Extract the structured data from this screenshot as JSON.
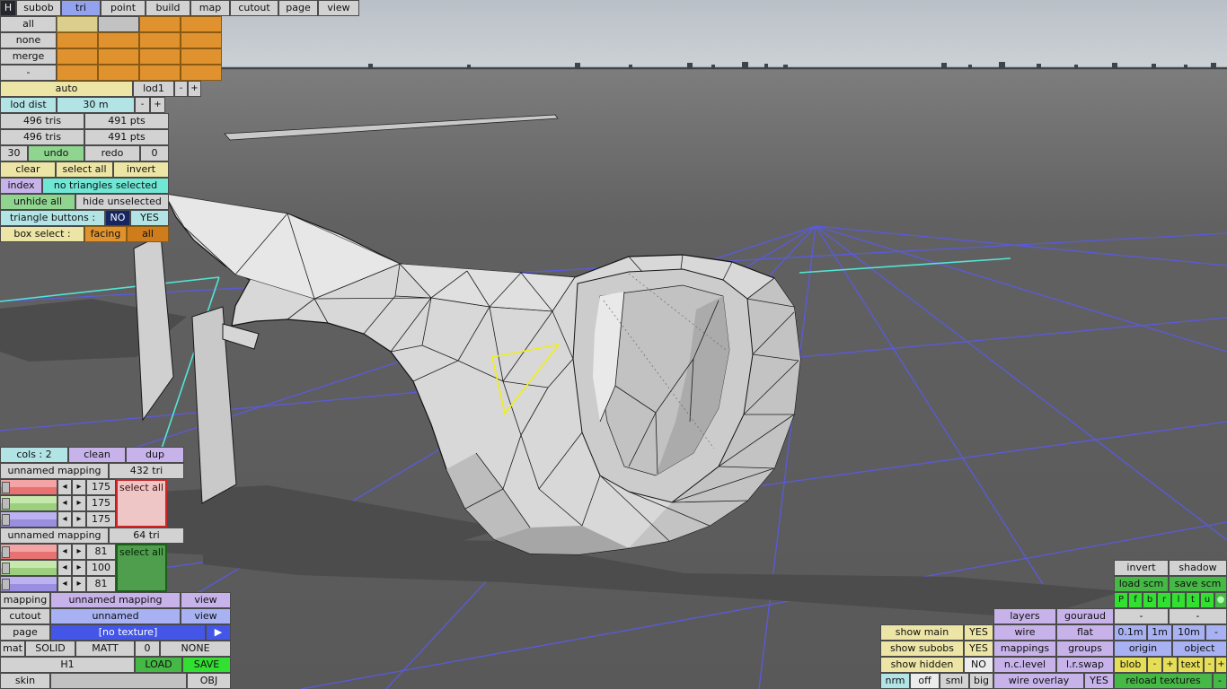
{
  "topbar": {
    "items": [
      "H",
      "subob",
      "tri",
      "point",
      "build",
      "map",
      "cutout",
      "page",
      "view"
    ]
  },
  "toolPanel": {
    "side": [
      "all",
      "none",
      "merge",
      "-"
    ],
    "autoRow": {
      "auto": "auto",
      "lod": "lod1",
      "minus": "-",
      "plus": "+"
    },
    "lodDist": {
      "label": "lod dist",
      "value": "30 m",
      "minus": "-",
      "plus": "+"
    },
    "stats": {
      "tris": "496 tris",
      "pts": "491 pts",
      "tris2": "496 tris",
      "pts2": "491 pts"
    },
    "undoRow": {
      "count": "30",
      "undo": "undo",
      "redo": "redo",
      "zero": "0"
    },
    "selRow": {
      "clear": "clear",
      "selectAll": "select all",
      "invert": "invert"
    },
    "indexRow": {
      "label": "index",
      "status": "no triangles selected"
    },
    "hideRow": {
      "unhide": "unhide all",
      "hideUnselected": "hide unselected"
    },
    "triRow": {
      "label": "triangle buttons :",
      "no": "NO",
      "yes": "YES"
    },
    "boxRow": {
      "label": "box select :",
      "facing": "facing",
      "all": "all"
    }
  },
  "colsPanel": {
    "header": {
      "cols": "cols : 2",
      "clean": "clean",
      "dup": "dup"
    },
    "arrows": {
      "left": "◂",
      "right": "▸"
    },
    "groups": [
      {
        "name": "unnamed mapping",
        "count": "432 tri",
        "selectAll": "select all",
        "values": [
          "175",
          "175",
          "175"
        ]
      },
      {
        "name": "unnamed mapping",
        "count": "64 tri",
        "selectAll": "select all",
        "values": [
          "81",
          "100",
          "81"
        ]
      }
    ],
    "mappingRow": {
      "label": "mapping",
      "value": "unnamed mapping",
      "view": "view"
    },
    "cutoutRow": {
      "label": "cutout",
      "value": "unnamed",
      "view": "view"
    },
    "pageRow": {
      "label": "page",
      "value": "[no texture]",
      "arrow": "▶"
    },
    "matRow": {
      "label": "mat",
      "a": "SOLID",
      "b": "MATT",
      "c": "0",
      "d": "NONE"
    },
    "fileRow": {
      "name": "H1",
      "load": "LOAD",
      "save": "SAVE"
    },
    "skinRow": {
      "label": "skin",
      "obj": "OBJ"
    }
  },
  "rightPanel": {
    "util": {
      "invert": "invert",
      "shadow": "shadow",
      "loadScm": "load scm",
      "saveScm": "save scm",
      "dash1": "-",
      "dash2": "-"
    },
    "views": [
      "P",
      "f",
      "b",
      "r",
      "l",
      "t",
      "u",
      "●"
    ],
    "layersRow": {
      "layers": "layers",
      "gouraud": "gouraud"
    },
    "row1": {
      "showMain": "show main",
      "val": "YES",
      "wire": "wire",
      "flat": "flat",
      "g1": "0.1m",
      "g2": "1m",
      "g3": "10m",
      "g4": "-"
    },
    "row2": {
      "showSubobs": "show subobs",
      "val": "YES",
      "mappings": "mappings",
      "groups": "groups",
      "origin": "origin",
      "object": "object"
    },
    "row3": {
      "showHidden": "show hidden",
      "val": "NO",
      "nc": "n.c.level",
      "lr": "l.r.swap",
      "blob": "blob",
      "bm": "-",
      "bp": "+",
      "text": "text",
      "tm": "-",
      "tp": "+"
    },
    "row4": {
      "nrm": "nrm",
      "off": "off",
      "sml": "sml",
      "big": "big",
      "wireOverlay": "wire overlay",
      "val": "YES",
      "reload": "reload textures",
      "dash": "-"
    }
  },
  "colors": {
    "accentSelect": "#93a2ee",
    "highlightTriangle": "#f0ee18",
    "gridBlue": "#5a5aec",
    "gridCyan": "#52e6d6"
  }
}
